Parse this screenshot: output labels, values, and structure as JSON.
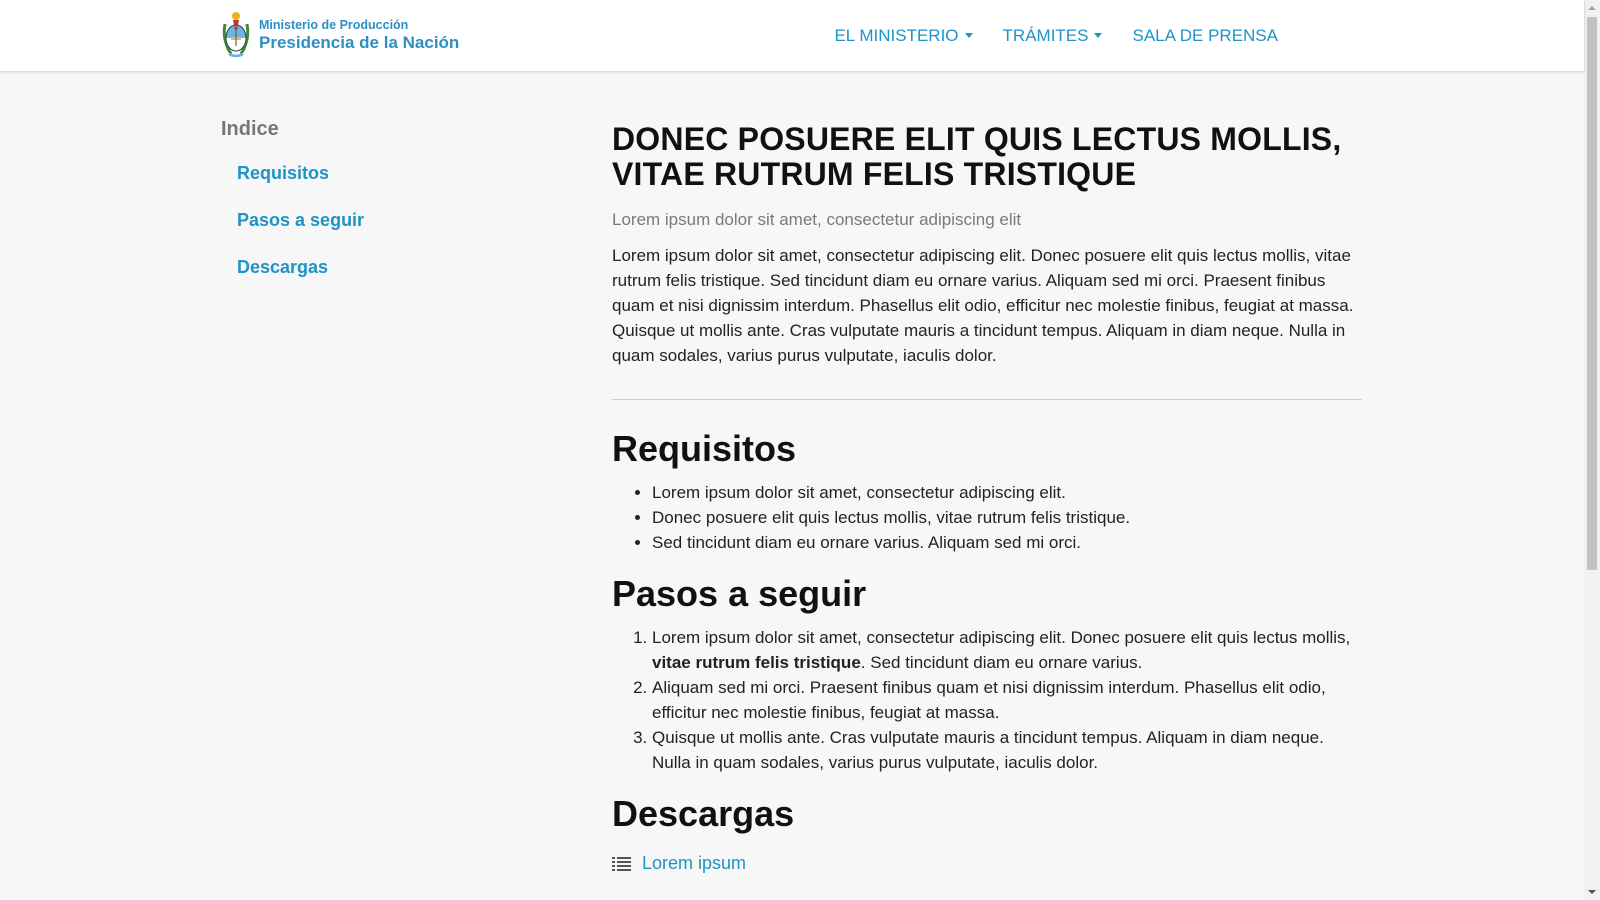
{
  "header": {
    "logo": {
      "line1": "Ministerio de Producción",
      "line2": "Presidencia de la Nación"
    },
    "nav": [
      {
        "label": "EL MINISTERIO",
        "dropdown": true
      },
      {
        "label": "TRÁMITES",
        "dropdown": true
      },
      {
        "label": "SALA DE PRENSA",
        "dropdown": false
      }
    ]
  },
  "sidebar": {
    "title": "Indice",
    "items": [
      {
        "label": "Requisitos"
      },
      {
        "label": "Pasos a seguir"
      },
      {
        "label": "Descargas"
      }
    ]
  },
  "main": {
    "title": "DONEC POSUERE ELIT QUIS LECTUS MOLLIS, VITAE RUTRUM FELIS TRISTIQUE",
    "lead": "Lorem ipsum dolor sit amet, consectetur adipiscing elit",
    "intro": "Lorem ipsum dolor sit amet, consectetur adipiscing elit. Donec posuere elit quis lectus mollis, vitae rutrum felis tristique. Sed tincidunt diam eu ornare varius. Aliquam sed mi orci. Praesent finibus quam et nisi dignissim interdum. Phasellus elit odio, efficitur nec molestie finibus, feugiat at massa. Quisque ut mollis ante. Cras vulputate mauris a tincidunt tempus. Aliquam in diam neque. Nulla in quam sodales, varius purus vulputate, iaculis dolor.",
    "requisitos": {
      "heading": "Requisitos",
      "items": [
        "Lorem ipsum dolor sit amet, consectetur adipiscing elit.",
        "Donec posuere elit quis lectus mollis, vitae rutrum felis tristique.",
        "Sed tincidunt diam eu ornare varius. Aliquam sed mi orci."
      ]
    },
    "pasos": {
      "heading": "Pasos a seguir",
      "step1": {
        "before": "Lorem ipsum dolor sit amet, consectetur adipiscing elit. Donec posuere elit quis lectus mollis, ",
        "bold": "vitae rutrum felis tristique",
        "after": ". Sed tincidunt diam eu ornare varius."
      },
      "step2": "Aliquam sed mi orci. Praesent finibus quam et nisi dignissim interdum. Phasellus elit odio, efficitur nec molestie finibus, feugiat at massa.",
      "step3": "Quisque ut mollis ante. Cras vulputate mauris a tincidunt tempus. Aliquam in diam neque. Nulla in quam sodales, varius purus vulputate, iaculis dolor."
    },
    "descargas": {
      "heading": "Descargas",
      "items": [
        {
          "label": "Lorem ipsum",
          "icon": "list-icon"
        }
      ]
    }
  },
  "colors": {
    "accent": "#1d93c8",
    "background": "#f7f7f7",
    "header_bg": "#ffffff"
  }
}
